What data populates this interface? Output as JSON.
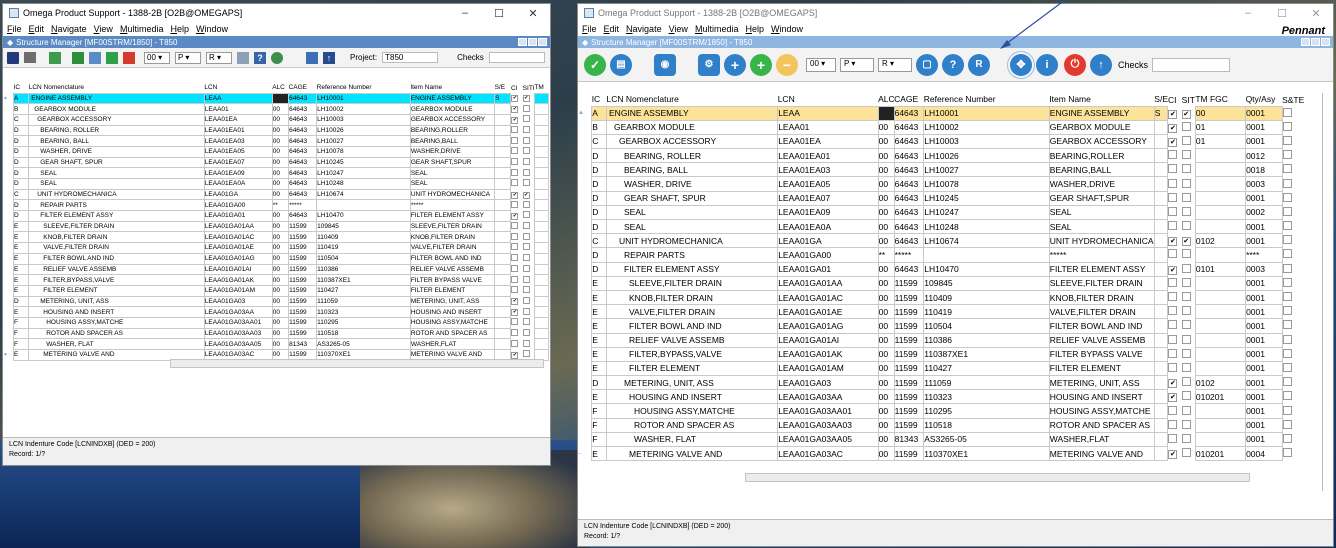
{
  "left_window": {
    "title": "Omega Product Support - 1388-2B [O2B@OMEGAPS]",
    "menu": [
      "File",
      "Edit",
      "Navigate",
      "View",
      "Multimedia",
      "Help",
      "Window"
    ],
    "inner_title": "Structure Manager [MF00STRM/1850] - T850",
    "level_value": "00",
    "p_value": "P",
    "r_value": "R",
    "project_label": "Project:",
    "project_value": "T850",
    "checks_label": "Checks",
    "status_text": "LCN Indenture Code [LCNINDXB] (DED = 200)",
    "record_text": "Record: 1/?"
  },
  "right_window": {
    "title": "Omega Product Support - 1388-2B [O2B@OMEGAPS]",
    "menu": [
      "File",
      "Edit",
      "Navigate",
      "View",
      "Multimedia",
      "Help",
      "Window"
    ],
    "inner_title": "Structure Manager [MF00STRM/1850] - T850",
    "brand": "Pennant",
    "level_value": "00",
    "p_value": "P",
    "r_value": "R",
    "checks_label": "Checks",
    "status_text": "LCN Indenture Code [LCNINDXB] (DED = 200)",
    "record_text": "Record: 1/?"
  },
  "columns_left": [
    "IC",
    "LCN Nomenclature",
    "LCN",
    "ALC",
    "CAGE",
    "Reference Number",
    "Item Name",
    "S/E",
    "CI",
    "SITI",
    "TM"
  ],
  "columns_right": [
    "IC",
    "LCN Nomenclature",
    "LCN",
    "ALC",
    "CAGE",
    "Reference Number",
    "Item Name",
    "S/E",
    "CI",
    "SITI",
    "TM FGC",
    "Qty/Asy",
    "S&TE"
  ],
  "rows": [
    {
      "ic": "A",
      "nom": "ENGINE ASSEMBLY",
      "lcn": "LEAA",
      "alc": "",
      "cage": "64643",
      "ref": "LH10001",
      "item": "ENGINE ASSEMBLY",
      "se": "S",
      "ci": true,
      "siti": true,
      "fgc": "00",
      "qty": "0001",
      "indent": 0
    },
    {
      "ic": "B",
      "nom": "GEARBOX MODULE",
      "lcn": "LEAA01",
      "alc": "00",
      "cage": "64643",
      "ref": "LH10002",
      "item": "GEARBOX MODULE",
      "se": "",
      "ci": true,
      "siti": false,
      "fgc": "01",
      "qty": "0001",
      "indent": 1
    },
    {
      "ic": "C",
      "nom": "GEARBOX ACCESSORY",
      "lcn": "LEAA01EA",
      "alc": "00",
      "cage": "64643",
      "ref": "LH10003",
      "item": "GEARBOX ACCESSORY",
      "se": "",
      "ci": true,
      "siti": false,
      "fgc": "01",
      "qty": "0001",
      "indent": 2
    },
    {
      "ic": "D",
      "nom": "BEARING, ROLLER",
      "lcn": "LEAA01EA01",
      "alc": "00",
      "cage": "64643",
      "ref": "LH10026",
      "item": "BEARING,ROLLER",
      "se": "",
      "ci": false,
      "siti": false,
      "fgc": "",
      "qty": "0012",
      "indent": 3
    },
    {
      "ic": "D",
      "nom": "BEARING, BALL",
      "lcn": "LEAA01EA03",
      "alc": "00",
      "cage": "64643",
      "ref": "LH10027",
      "item": "BEARING,BALL",
      "se": "",
      "ci": false,
      "siti": false,
      "fgc": "",
      "qty": "0018",
      "indent": 3
    },
    {
      "ic": "D",
      "nom": "WASHER, DRIVE",
      "lcn": "LEAA01EA05",
      "alc": "00",
      "cage": "64643",
      "ref": "LH10078",
      "item": "WASHER,DRIVE",
      "se": "",
      "ci": false,
      "siti": false,
      "fgc": "",
      "qty": "0003",
      "indent": 3
    },
    {
      "ic": "D",
      "nom": "GEAR SHAFT, SPUR",
      "lcn": "LEAA01EA07",
      "alc": "00",
      "cage": "64643",
      "ref": "LH10245",
      "item": "GEAR SHAFT,SPUR",
      "se": "",
      "ci": false,
      "siti": false,
      "fgc": "",
      "qty": "0001",
      "indent": 3
    },
    {
      "ic": "D",
      "nom": "SEAL",
      "lcn": "LEAA01EA09",
      "alc": "00",
      "cage": "64643",
      "ref": "LH10247",
      "item": "SEAL",
      "se": "",
      "ci": false,
      "siti": false,
      "fgc": "",
      "qty": "0002",
      "indent": 3
    },
    {
      "ic": "D",
      "nom": "SEAL",
      "lcn": "LEAA01EA0A",
      "alc": "00",
      "cage": "64643",
      "ref": "LH10248",
      "item": "SEAL",
      "se": "",
      "ci": false,
      "siti": false,
      "fgc": "",
      "qty": "0001",
      "indent": 3
    },
    {
      "ic": "C",
      "nom": "UNIT HYDROMECHANICA",
      "lcn": "LEAA01GA",
      "alc": "00",
      "cage": "64643",
      "ref": "LH10674",
      "item": "UNIT HYDROMECHANICA",
      "se": "",
      "ci": true,
      "siti": true,
      "fgc": "0102",
      "qty": "0001",
      "indent": 2
    },
    {
      "ic": "D",
      "nom": "REPAIR PARTS",
      "lcn": "LEAA01GA00",
      "alc": "**",
      "cage": "*****",
      "ref": "",
      "item": "*****",
      "se": "",
      "ci": false,
      "siti": false,
      "fgc": "",
      "qty": "****",
      "indent": 3
    },
    {
      "ic": "D",
      "nom": "FILTER ELEMENT ASSY",
      "lcn": "LEAA01GA01",
      "alc": "00",
      "cage": "64643",
      "ref": "LH10470",
      "item": "FILTER ELEMENT ASSY",
      "se": "",
      "ci": true,
      "siti": false,
      "fgc": "0101",
      "qty": "0003",
      "indent": 3
    },
    {
      "ic": "E",
      "nom": "SLEEVE,FILTER DRAIN",
      "lcn": "LEAA01GA01AA",
      "alc": "00",
      "cage": "11599",
      "ref": "109845",
      "item": "SLEEVE,FILTER DRAIN",
      "se": "",
      "ci": false,
      "siti": false,
      "fgc": "",
      "qty": "0001",
      "indent": 4
    },
    {
      "ic": "E",
      "nom": "KNOB,FILTER DRAIN",
      "lcn": "LEAA01GA01AC",
      "alc": "00",
      "cage": "11599",
      "ref": "110409",
      "item": "KNOB,FILTER DRAIN",
      "se": "",
      "ci": false,
      "siti": false,
      "fgc": "",
      "qty": "0001",
      "indent": 4
    },
    {
      "ic": "E",
      "nom": "VALVE,FILTER DRAIN",
      "lcn": "LEAA01GA01AE",
      "alc": "00",
      "cage": "11599",
      "ref": "110419",
      "item": "VALVE,FILTER DRAIN",
      "se": "",
      "ci": false,
      "siti": false,
      "fgc": "",
      "qty": "0001",
      "indent": 4
    },
    {
      "ic": "E",
      "nom": "FILTER BOWL AND IND",
      "lcn": "LEAA01GA01AG",
      "alc": "00",
      "cage": "11599",
      "ref": "110504",
      "item": "FILTER BOWL AND IND",
      "se": "",
      "ci": false,
      "siti": false,
      "fgc": "",
      "qty": "0001",
      "indent": 4
    },
    {
      "ic": "E",
      "nom": "RELIEF VALVE ASSEMB",
      "lcn": "LEAA01GA01AI",
      "alc": "00",
      "cage": "11599",
      "ref": "110386",
      "item": "RELIEF VALVE ASSEMB",
      "se": "",
      "ci": false,
      "siti": false,
      "fgc": "",
      "qty": "0001",
      "indent": 4
    },
    {
      "ic": "E",
      "nom": "FILTER,BYPASS,VALVE",
      "lcn": "LEAA01GA01AK",
      "alc": "00",
      "cage": "11599",
      "ref": "110387XE1",
      "item": "FILTER BYPASS VALVE",
      "se": "",
      "ci": false,
      "siti": false,
      "fgc": "",
      "qty": "0001",
      "indent": 4
    },
    {
      "ic": "E",
      "nom": "FILTER ELEMENT",
      "lcn": "LEAA01GA01AM",
      "alc": "00",
      "cage": "11599",
      "ref": "110427",
      "item": "FILTER ELEMENT",
      "se": "",
      "ci": false,
      "siti": false,
      "fgc": "",
      "qty": "0001",
      "indent": 4
    },
    {
      "ic": "D",
      "nom": "METERING, UNIT, ASS",
      "lcn": "LEAA01GA03",
      "alc": "00",
      "cage": "11599",
      "ref": "111059",
      "item": "METERING, UNIT, ASS",
      "se": "",
      "ci": true,
      "siti": false,
      "fgc": "0102",
      "qty": "0001",
      "indent": 3
    },
    {
      "ic": "E",
      "nom": "HOUSING AND INSERT",
      "lcn": "LEAA01GA03AA",
      "alc": "00",
      "cage": "11599",
      "ref": "110323",
      "item": "HOUSING AND INSERT",
      "se": "",
      "ci": true,
      "siti": false,
      "fgc": "010201",
      "qty": "0001",
      "indent": 4
    },
    {
      "ic": "F",
      "nom": "HOUSING ASSY,MATCHE",
      "lcn": "LEAA01GA03AA01",
      "alc": "00",
      "cage": "11599",
      "ref": "110295",
      "item": "HOUSING ASSY,MATCHE",
      "se": "",
      "ci": false,
      "siti": false,
      "fgc": "",
      "qty": "0001",
      "indent": 5
    },
    {
      "ic": "F",
      "nom": "ROTOR AND SPACER AS",
      "lcn": "LEAA01GA03AA03",
      "alc": "00",
      "cage": "11599",
      "ref": "110518",
      "item": "ROTOR AND SPACER AS",
      "se": "",
      "ci": false,
      "siti": false,
      "fgc": "",
      "qty": "0001",
      "indent": 5
    },
    {
      "ic": "F",
      "nom": "WASHER, FLAT",
      "lcn": "LEAA01GA03AA05",
      "alc": "00",
      "cage": "81343",
      "ref": "AS3265-05",
      "item": "WASHER,FLAT",
      "se": "",
      "ci": false,
      "siti": false,
      "fgc": "",
      "qty": "0001",
      "indent": 5
    },
    {
      "ic": "E",
      "nom": "METERING VALVE AND",
      "lcn": "LEAA01GA03AC",
      "alc": "00",
      "cage": "11599",
      "ref": "110370XE1",
      "item": "METERING VALVE AND",
      "se": "",
      "ci": true,
      "siti": false,
      "fgc": "010201",
      "qty": "0004",
      "indent": 4
    }
  ],
  "colors": {
    "inner_title_bg": "#5b89c4",
    "selected_row_left": "#00e5ff",
    "selected_row_right": "#fde29a",
    "icon_green": "#38b44a",
    "icon_blue": "#2f7fc9",
    "icon_red": "#e23b2e",
    "arrow": "#2a4f9a"
  },
  "icons_right": [
    "checkmark-icon",
    "print-icon",
    "camera-icon",
    "save-icon",
    "search-plus-icon",
    "add-icon",
    "add-green-icon",
    "remove-icon",
    "level-dropdown",
    "p-dropdown",
    "r-dropdown",
    "new-doc-icon",
    "help-icon",
    "report-icon",
    "navigate-icon",
    "info-icon",
    "stop-icon",
    "up-icon"
  ]
}
